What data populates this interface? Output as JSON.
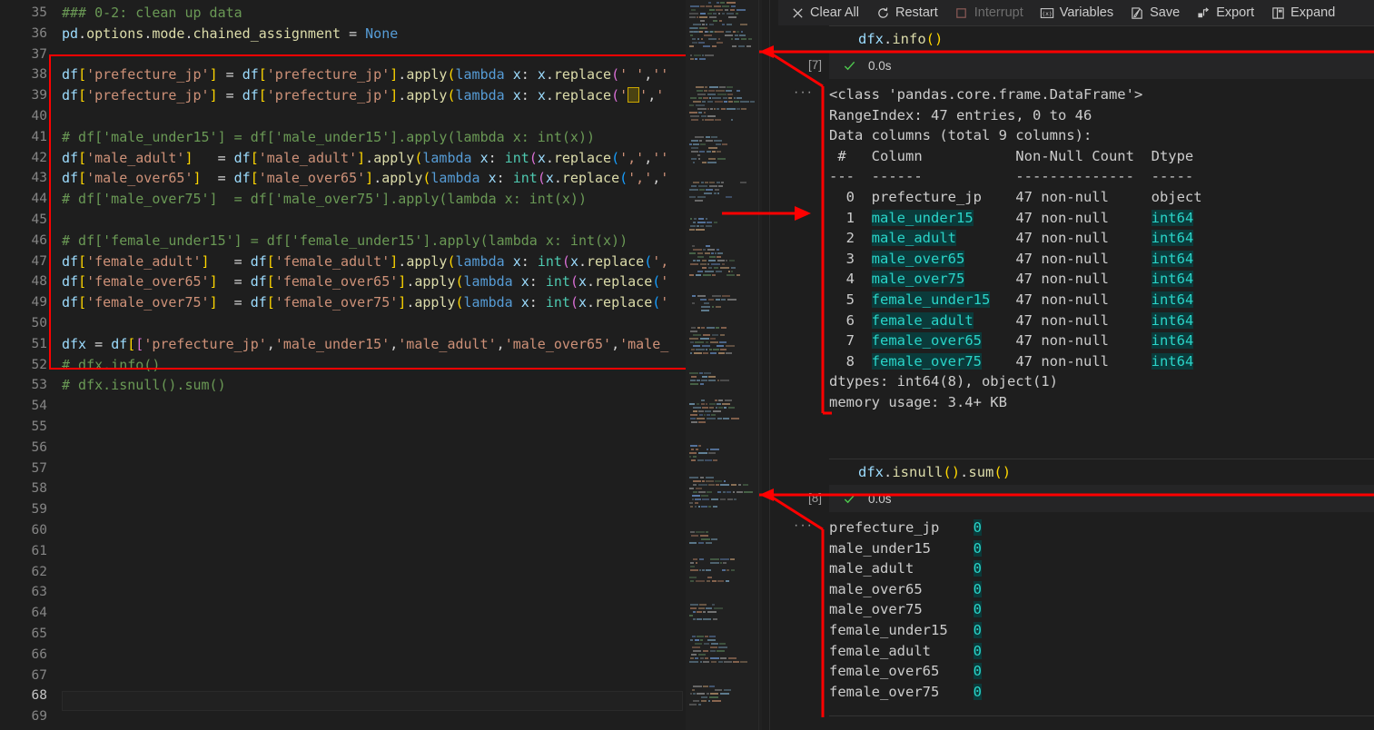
{
  "editor": {
    "first_line": 35,
    "active_line": 68,
    "lines": [
      {
        "n": 35,
        "text": "### 0-2: clean up data"
      },
      {
        "n": 36,
        "text": "pd.options.mode.chained_assignment = None"
      },
      {
        "n": 37,
        "text": ""
      },
      {
        "n": 38,
        "text": "df['prefecture_jp'] = df['prefecture_jp'].apply(lambda x: x.replace(' ',''"
      },
      {
        "n": 39,
        "text": "df['prefecture_jp'] = df['prefecture_jp'].apply(lambda x: x.replace('□','"
      },
      {
        "n": 40,
        "text": ""
      },
      {
        "n": 41,
        "text": "# df['male_under15'] = df['male_under15'].apply(lambda x: int(x))"
      },
      {
        "n": 42,
        "text": "df['male_adult']   = df['male_adult'].apply(lambda x: int(x.replace(',',''"
      },
      {
        "n": 43,
        "text": "df['male_over65']  = df['male_over65'].apply(lambda x: int(x.replace(',','"
      },
      {
        "n": 44,
        "text": "# df['male_over75']  = df['male_over75'].apply(lambda x: int(x))"
      },
      {
        "n": 45,
        "text": ""
      },
      {
        "n": 46,
        "text": "# df['female_under15'] = df['female_under15'].apply(lambda x: int(x))"
      },
      {
        "n": 47,
        "text": "df['female_adult']   = df['female_adult'].apply(lambda x: int(x.replace(',"
      },
      {
        "n": 48,
        "text": "df['female_over65']  = df['female_over65'].apply(lambda x: int(x.replace('"
      },
      {
        "n": 49,
        "text": "df['female_over75']  = df['female_over75'].apply(lambda x: int(x.replace('"
      },
      {
        "n": 50,
        "text": ""
      },
      {
        "n": 51,
        "text": "dfx = df[['prefecture_jp','male_under15','male_adult','male_over65','male_"
      },
      {
        "n": 52,
        "text": "# dfx.info()"
      },
      {
        "n": 53,
        "text": "# dfx.isnull().sum()"
      },
      {
        "n": 54,
        "text": ""
      },
      {
        "n": 55,
        "text": ""
      },
      {
        "n": 56,
        "text": ""
      },
      {
        "n": 57,
        "text": ""
      },
      {
        "n": 58,
        "text": ""
      },
      {
        "n": 59,
        "text": ""
      },
      {
        "n": 60,
        "text": ""
      },
      {
        "n": 61,
        "text": ""
      },
      {
        "n": 62,
        "text": ""
      },
      {
        "n": 63,
        "text": ""
      },
      {
        "n": 64,
        "text": ""
      },
      {
        "n": 65,
        "text": ""
      },
      {
        "n": 66,
        "text": ""
      },
      {
        "n": 67,
        "text": ""
      },
      {
        "n": 68,
        "text": ""
      },
      {
        "n": 69,
        "text": ""
      }
    ]
  },
  "toolbar": {
    "items": [
      {
        "label": "Clear All",
        "icon": "close-icon",
        "disabled": false
      },
      {
        "label": "Restart",
        "icon": "restart-icon",
        "disabled": false
      },
      {
        "label": "Interrupt",
        "icon": "stop-square-icon",
        "disabled": true
      },
      {
        "label": "Variables",
        "icon": "variables-icon",
        "disabled": false
      },
      {
        "label": "Save",
        "icon": "save-icon",
        "disabled": false
      },
      {
        "label": "Export",
        "icon": "export-icon",
        "disabled": false
      },
      {
        "label": "Expand",
        "icon": "expand-icon",
        "disabled": false
      }
    ]
  },
  "cells": [
    {
      "exec_count": "[7]",
      "code": "dfx.info()",
      "status_icon": "check-icon",
      "duration": "0.0s",
      "dots": "···",
      "output": {
        "header_lines": [
          "<class 'pandas.core.frame.DataFrame'>",
          "RangeIndex: 47 entries, 0 to 46",
          "Data columns (total 9 columns):"
        ],
        "table_header": " #   Column           Non-Null Count  Dtype",
        "table_rule": "---  ------           --------------  -----",
        "rows": [
          {
            "idx": " 0",
            "column": "prefecture_jp",
            "nonnull": "47 non-null",
            "dtype": "object",
            "highlight": false
          },
          {
            "idx": " 1",
            "column": "male_under15",
            "nonnull": "47 non-null",
            "dtype": "int64",
            "highlight": true
          },
          {
            "idx": " 2",
            "column": "male_adult",
            "nonnull": "47 non-null",
            "dtype": "int64",
            "highlight": true
          },
          {
            "idx": " 3",
            "column": "male_over65",
            "nonnull": "47 non-null",
            "dtype": "int64",
            "highlight": true
          },
          {
            "idx": " 4",
            "column": "male_over75",
            "nonnull": "47 non-null",
            "dtype": "int64",
            "highlight": true
          },
          {
            "idx": " 5",
            "column": "female_under15",
            "nonnull": "47 non-null",
            "dtype": "int64",
            "highlight": true
          },
          {
            "idx": " 6",
            "column": "female_adult",
            "nonnull": "47 non-null",
            "dtype": "int64",
            "highlight": true
          },
          {
            "idx": " 7",
            "column": "female_over65",
            "nonnull": "47 non-null",
            "dtype": "int64",
            "highlight": true
          },
          {
            "idx": " 8",
            "column": "female_over75",
            "nonnull": "47 non-null",
            "dtype": "int64",
            "highlight": true
          }
        ],
        "footer_lines": [
          "dtypes: int64(8), object(1)",
          "memory usage: 3.4+ KB"
        ]
      }
    },
    {
      "exec_count": "[8]",
      "code": "dfx.isnull().sum()",
      "status_icon": "check-icon",
      "duration": "0.0s",
      "dots": "···",
      "output": {
        "rows": [
          {
            "column": "prefecture_jp",
            "value": "0"
          },
          {
            "column": "male_under15",
            "value": "0"
          },
          {
            "column": "male_adult",
            "value": "0"
          },
          {
            "column": "male_over65",
            "value": "0"
          },
          {
            "column": "male_over75",
            "value": "0"
          },
          {
            "column": "female_under15",
            "value": "0"
          },
          {
            "column": "female_adult",
            "value": "0"
          },
          {
            "column": "female_over65",
            "value": "0"
          },
          {
            "column": "female_over75",
            "value": "0"
          }
        ]
      }
    }
  ],
  "annotations": {
    "color": "#ff0000",
    "shapes": [
      "selection-rect-lines-38-51",
      "arrow-to-minimap-cell7",
      "arrow-right-midpage",
      "bracket-output-7",
      "arrow-to-minimap-cell8",
      "bracket-output-8"
    ]
  },
  "colors": {
    "background": "#1e1e1e",
    "toolbar_bg": "#252526",
    "accent_teal": "#2ad4c8",
    "highlight_bg": "#0b3a3a",
    "annotation_red": "#ff0000",
    "comment_green": "#6A9955",
    "string_orange": "#CE9178",
    "keyword_blue": "#569CD6"
  }
}
